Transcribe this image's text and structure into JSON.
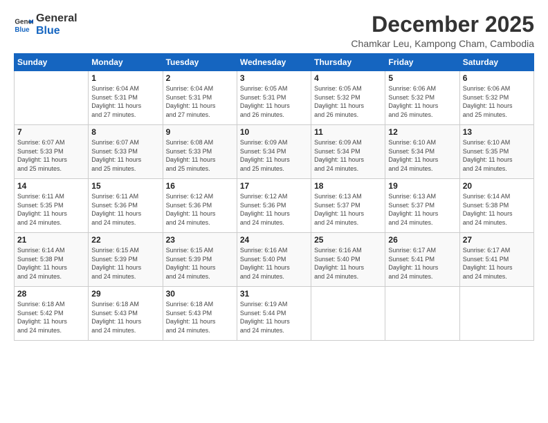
{
  "logo": {
    "text_general": "General",
    "text_blue": "Blue"
  },
  "header": {
    "month_title": "December 2025",
    "subtitle": "Chamkar Leu, Kampong Cham, Cambodia"
  },
  "weekdays": [
    "Sunday",
    "Monday",
    "Tuesday",
    "Wednesday",
    "Thursday",
    "Friday",
    "Saturday"
  ],
  "weeks": [
    [
      {
        "day": "",
        "info": ""
      },
      {
        "day": "1",
        "info": "Sunrise: 6:04 AM\nSunset: 5:31 PM\nDaylight: 11 hours\nand 27 minutes."
      },
      {
        "day": "2",
        "info": "Sunrise: 6:04 AM\nSunset: 5:31 PM\nDaylight: 11 hours\nand 27 minutes."
      },
      {
        "day": "3",
        "info": "Sunrise: 6:05 AM\nSunset: 5:31 PM\nDaylight: 11 hours\nand 26 minutes."
      },
      {
        "day": "4",
        "info": "Sunrise: 6:05 AM\nSunset: 5:32 PM\nDaylight: 11 hours\nand 26 minutes."
      },
      {
        "day": "5",
        "info": "Sunrise: 6:06 AM\nSunset: 5:32 PM\nDaylight: 11 hours\nand 26 minutes."
      },
      {
        "day": "6",
        "info": "Sunrise: 6:06 AM\nSunset: 5:32 PM\nDaylight: 11 hours\nand 25 minutes."
      }
    ],
    [
      {
        "day": "7",
        "info": "Sunrise: 6:07 AM\nSunset: 5:33 PM\nDaylight: 11 hours\nand 25 minutes."
      },
      {
        "day": "8",
        "info": "Sunrise: 6:07 AM\nSunset: 5:33 PM\nDaylight: 11 hours\nand 25 minutes."
      },
      {
        "day": "9",
        "info": "Sunrise: 6:08 AM\nSunset: 5:33 PM\nDaylight: 11 hours\nand 25 minutes."
      },
      {
        "day": "10",
        "info": "Sunrise: 6:09 AM\nSunset: 5:34 PM\nDaylight: 11 hours\nand 25 minutes."
      },
      {
        "day": "11",
        "info": "Sunrise: 6:09 AM\nSunset: 5:34 PM\nDaylight: 11 hours\nand 24 minutes."
      },
      {
        "day": "12",
        "info": "Sunrise: 6:10 AM\nSunset: 5:34 PM\nDaylight: 11 hours\nand 24 minutes."
      },
      {
        "day": "13",
        "info": "Sunrise: 6:10 AM\nSunset: 5:35 PM\nDaylight: 11 hours\nand 24 minutes."
      }
    ],
    [
      {
        "day": "14",
        "info": "Sunrise: 6:11 AM\nSunset: 5:35 PM\nDaylight: 11 hours\nand 24 minutes."
      },
      {
        "day": "15",
        "info": "Sunrise: 6:11 AM\nSunset: 5:36 PM\nDaylight: 11 hours\nand 24 minutes."
      },
      {
        "day": "16",
        "info": "Sunrise: 6:12 AM\nSunset: 5:36 PM\nDaylight: 11 hours\nand 24 minutes."
      },
      {
        "day": "17",
        "info": "Sunrise: 6:12 AM\nSunset: 5:36 PM\nDaylight: 11 hours\nand 24 minutes."
      },
      {
        "day": "18",
        "info": "Sunrise: 6:13 AM\nSunset: 5:37 PM\nDaylight: 11 hours\nand 24 minutes."
      },
      {
        "day": "19",
        "info": "Sunrise: 6:13 AM\nSunset: 5:37 PM\nDaylight: 11 hours\nand 24 minutes."
      },
      {
        "day": "20",
        "info": "Sunrise: 6:14 AM\nSunset: 5:38 PM\nDaylight: 11 hours\nand 24 minutes."
      }
    ],
    [
      {
        "day": "21",
        "info": "Sunrise: 6:14 AM\nSunset: 5:38 PM\nDaylight: 11 hours\nand 24 minutes."
      },
      {
        "day": "22",
        "info": "Sunrise: 6:15 AM\nSunset: 5:39 PM\nDaylight: 11 hours\nand 24 minutes."
      },
      {
        "day": "23",
        "info": "Sunrise: 6:15 AM\nSunset: 5:39 PM\nDaylight: 11 hours\nand 24 minutes."
      },
      {
        "day": "24",
        "info": "Sunrise: 6:16 AM\nSunset: 5:40 PM\nDaylight: 11 hours\nand 24 minutes."
      },
      {
        "day": "25",
        "info": "Sunrise: 6:16 AM\nSunset: 5:40 PM\nDaylight: 11 hours\nand 24 minutes."
      },
      {
        "day": "26",
        "info": "Sunrise: 6:17 AM\nSunset: 5:41 PM\nDaylight: 11 hours\nand 24 minutes."
      },
      {
        "day": "27",
        "info": "Sunrise: 6:17 AM\nSunset: 5:41 PM\nDaylight: 11 hours\nand 24 minutes."
      }
    ],
    [
      {
        "day": "28",
        "info": "Sunrise: 6:18 AM\nSunset: 5:42 PM\nDaylight: 11 hours\nand 24 minutes."
      },
      {
        "day": "29",
        "info": "Sunrise: 6:18 AM\nSunset: 5:43 PM\nDaylight: 11 hours\nand 24 minutes."
      },
      {
        "day": "30",
        "info": "Sunrise: 6:18 AM\nSunset: 5:43 PM\nDaylight: 11 hours\nand 24 minutes."
      },
      {
        "day": "31",
        "info": "Sunrise: 6:19 AM\nSunset: 5:44 PM\nDaylight: 11 hours\nand 24 minutes."
      },
      {
        "day": "",
        "info": ""
      },
      {
        "day": "",
        "info": ""
      },
      {
        "day": "",
        "info": ""
      }
    ]
  ]
}
